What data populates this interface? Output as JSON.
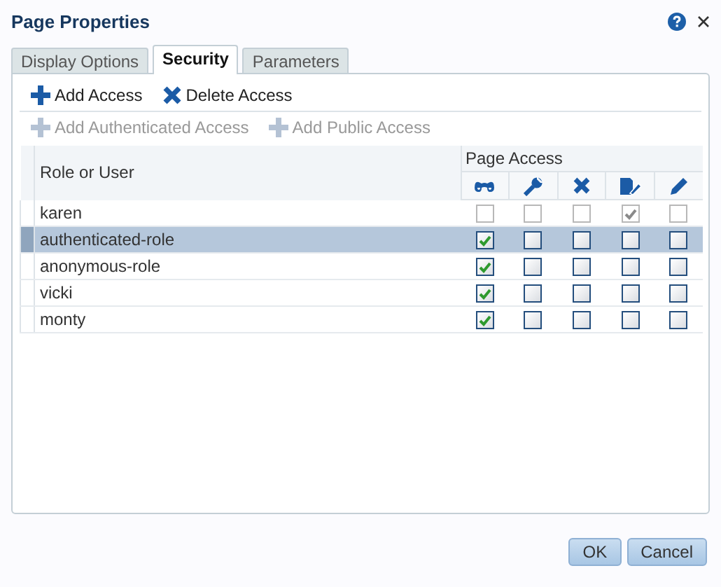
{
  "window": {
    "title": "Page Properties"
  },
  "tabs": [
    {
      "label": "Display Options",
      "selected": false
    },
    {
      "label": "Security",
      "selected": true
    },
    {
      "label": "Parameters",
      "selected": false
    }
  ],
  "toolbar": [
    {
      "kind": "add",
      "label": "Add Access",
      "disabled": false
    },
    {
      "kind": "delete",
      "label": "Delete Access",
      "disabled": false
    }
  ],
  "toolbar_2": [
    {
      "kind": "add",
      "label": "Add Authenticated Access",
      "disabled": true
    },
    {
      "kind": "add",
      "label": "Add Public Access",
      "disabled": true
    }
  ],
  "table": {
    "columns": {
      "role": "Role or User",
      "group": "Page Access",
      "permissions": [
        {
          "kind": "view"
        },
        {
          "kind": "customize"
        },
        {
          "kind": "delete"
        },
        {
          "kind": "manage"
        },
        {
          "kind": "edit"
        }
      ]
    },
    "rows": [
      {
        "name": "karen",
        "selected": false,
        "disabled": true,
        "checked": [
          false,
          false,
          false,
          true,
          false
        ]
      },
      {
        "name": "authenticated-role",
        "selected": true,
        "disabled": false,
        "checked": [
          true,
          false,
          false,
          false,
          false
        ]
      },
      {
        "name": "anonymous-role",
        "selected": false,
        "disabled": false,
        "checked": [
          true,
          false,
          false,
          false,
          false
        ]
      },
      {
        "name": "vicki",
        "selected": false,
        "disabled": false,
        "checked": [
          true,
          false,
          false,
          false,
          false
        ]
      },
      {
        "name": "monty",
        "selected": false,
        "disabled": false,
        "checked": [
          true,
          false,
          false,
          false,
          false
        ]
      }
    ]
  },
  "buttons": [
    "OK",
    "Cancel"
  ]
}
